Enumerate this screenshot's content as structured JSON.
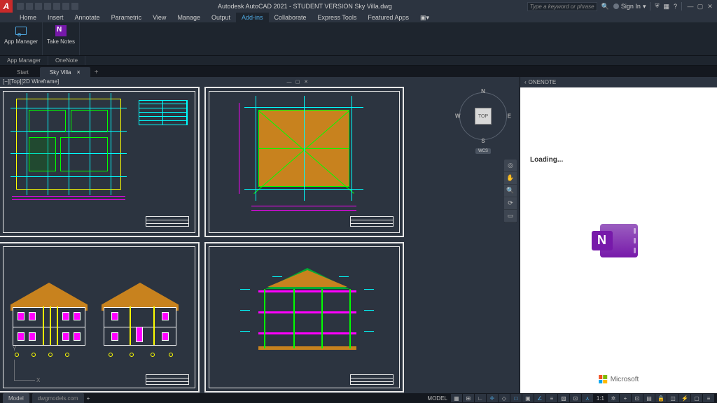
{
  "titlebar": {
    "title": "Autodesk AutoCAD 2021 - STUDENT VERSION    Sky Villa.dwg",
    "search_placeholder": "Type a keyword or phrase",
    "signin": "Sign In"
  },
  "menu": {
    "tabs": [
      "Home",
      "Insert",
      "Annotate",
      "Parametric",
      "View",
      "Manage",
      "Output",
      "Add-ins",
      "Collaborate",
      "Express Tools",
      "Featured Apps"
    ],
    "active_index": 7
  },
  "ribbon": {
    "buttons": [
      {
        "label": "App Manager"
      },
      {
        "label": "Take Notes"
      }
    ],
    "panels": [
      "App Manager",
      "OneNote"
    ]
  },
  "doc_tabs": {
    "tabs": [
      "Start",
      "Sky Villa"
    ],
    "active_index": 1
  },
  "viewport": {
    "label": "[−][Top][2D Wireframe]",
    "viewcube_face": "TOP",
    "compass": {
      "n": "N",
      "s": "S",
      "e": "E",
      "w": "W"
    },
    "wcs": "WCS",
    "ucs": {
      "x": "X",
      "y": "Y"
    }
  },
  "onenote": {
    "title": "ONENOTE",
    "loading": "Loading...",
    "brand": "Microsoft",
    "letter": "N"
  },
  "status": {
    "model": "Model",
    "layout": "dwgmodels.com",
    "mode": "MODEL",
    "scale": "1:1",
    "anno": "+"
  }
}
